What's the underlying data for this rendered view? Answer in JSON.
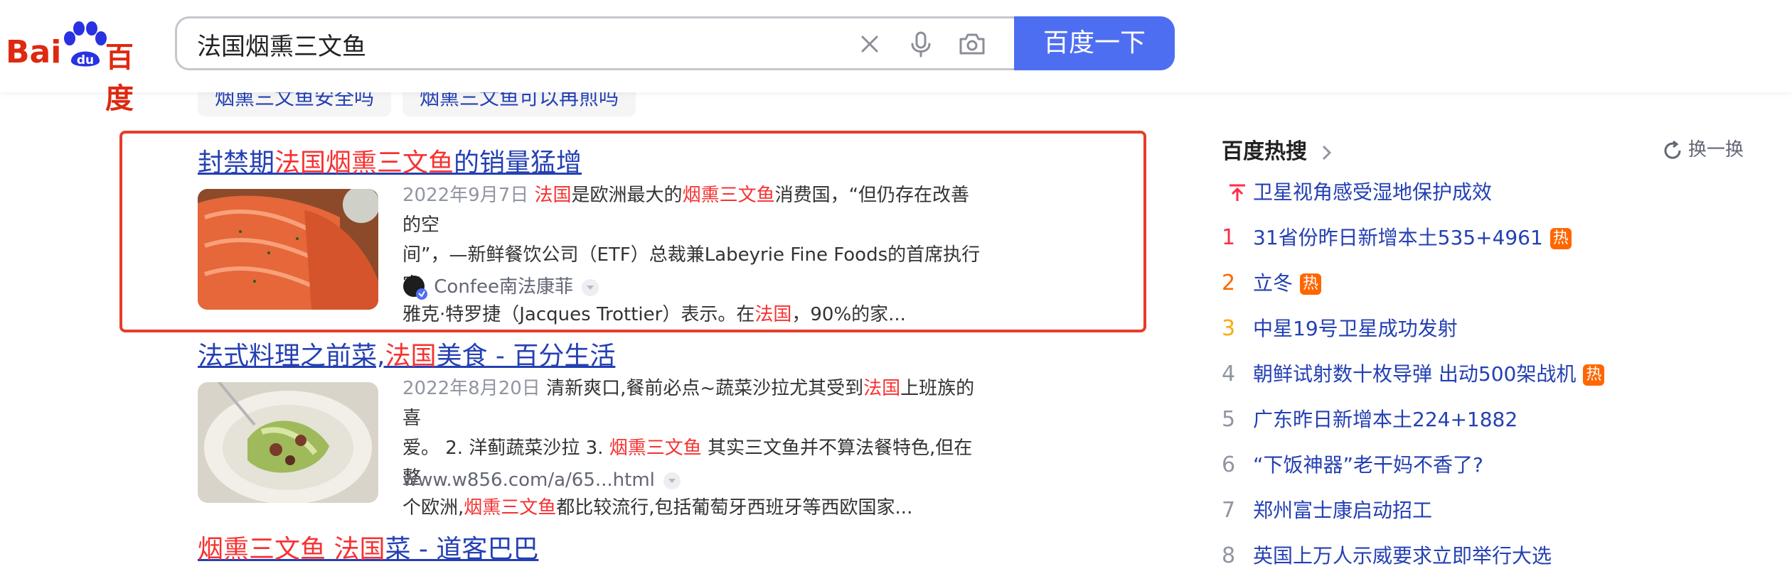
{
  "brand": {
    "logo_left": "Bai",
    "logo_paw": "du",
    "logo_right": "百度"
  },
  "search": {
    "query": "法国烟熏三文鱼",
    "button_label": "百度一下"
  },
  "related_queries": [
    "烟熏三文鱼安全吗",
    "烟熏三文鱼可以再煎吗"
  ],
  "results": [
    {
      "title_parts": [
        "封禁期",
        "法国烟熏三文鱼",
        "的销量猛增"
      ],
      "date": "2022年9月7日",
      "line1_parts": [
        "法国",
        "是欧洲最大的",
        "烟熏三文鱼",
        "消费国，“但仍存在改善的空"
      ],
      "line2": "间”，—新鲜餐饮公司（ETF）总裁兼Labeyrie Fine Foods的首席执行官",
      "line3_parts": [
        "雅克·特罗捷（Jacques Trottier）表示。在",
        "法国",
        "，90%的家..."
      ],
      "source": "Confee南法康菲"
    },
    {
      "title_parts": [
        "法式料理之前菜,",
        "法国",
        "美食 - 百分生活"
      ],
      "date": "2022年8月20日",
      "line1_parts": [
        "清新爽口,餐前必点~蔬菜沙拉尤其受到",
        "法国",
        "上班族的喜"
      ],
      "line2_parts": [
        "爱。 2. 洋蓟蔬菜沙拉 3. ",
        "烟熏三文鱼",
        " 其实三文鱼并不算法餐特色,但在整"
      ],
      "line3_parts": [
        "个欧洲,",
        "烟熏三文鱼",
        "都比较流行,包括葡萄牙西班牙等西欧国家..."
      ],
      "source": "www.w856.com/a/65...html"
    },
    {
      "title_parts": [
        "烟熏三文鱼",
        " ",
        "法国",
        "菜 - 道客巴巴"
      ]
    }
  ],
  "hot_search": {
    "title": "百度热搜",
    "refresh_label": "换一换",
    "hot_tag": "热",
    "items": [
      {
        "rank": "",
        "text": "卫星视角感受湿地保护成效",
        "tag": false
      },
      {
        "rank": "1",
        "text": "31省份昨日新增本土535+4961",
        "tag": true
      },
      {
        "rank": "2",
        "text": "立冬",
        "tag": true
      },
      {
        "rank": "3",
        "text": "中星19号卫星成功发射",
        "tag": false
      },
      {
        "rank": "4",
        "text": "朝鲜试射数十枚导弹 出动500架战机",
        "tag": true
      },
      {
        "rank": "5",
        "text": "广东昨日新增本土224+1882",
        "tag": false
      },
      {
        "rank": "6",
        "text": "“下饭神器”老干妈不香了?",
        "tag": false
      },
      {
        "rank": "7",
        "text": "郑州富士康启动招工",
        "tag": false
      },
      {
        "rank": "8",
        "text": "英国上万人示威要求立即举行大选",
        "tag": false
      }
    ],
    "rank_colors": [
      "#fe2d46",
      "#fe2d46",
      "#ff6600",
      "#faa90e",
      "#9195a3"
    ]
  },
  "colors": {
    "accent": "#4e6ef2",
    "link": "#2440b3",
    "highlight": "#f73131",
    "box": "#e53d2b"
  }
}
